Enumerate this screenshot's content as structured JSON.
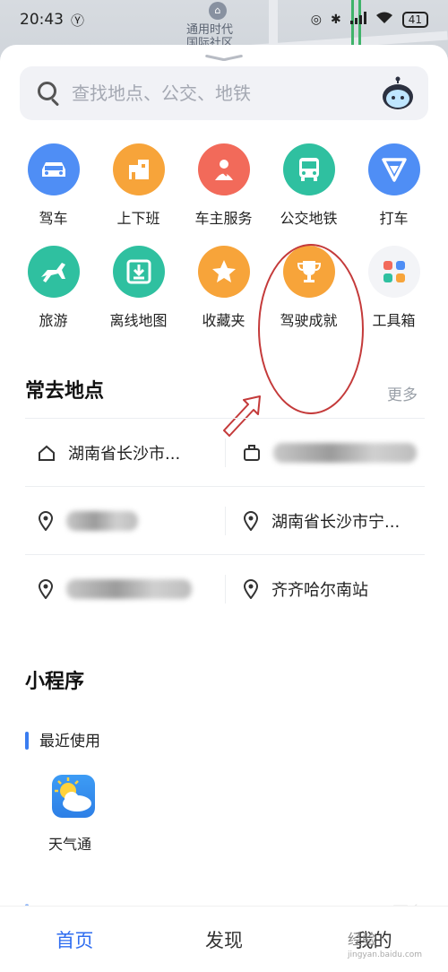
{
  "status": {
    "time": "20:43",
    "battery": "41"
  },
  "map": {
    "poi_line1": "通用时代",
    "poi_line2": "国际社区"
  },
  "search": {
    "placeholder": "查找地点、公交、地铁"
  },
  "grid": {
    "row1": [
      {
        "label": "驾车",
        "color": "#4f8ef5",
        "icon": "car-icon"
      },
      {
        "label": "上下班",
        "color": "#f7a43a",
        "icon": "commute-building-icon"
      },
      {
        "label": "车主服务",
        "color": "#f26a5a",
        "icon": "owner-service-icon"
      },
      {
        "label": "公交地铁",
        "color": "#2fc0a0",
        "icon": "bus-icon"
      },
      {
        "label": "打车",
        "color": "#4f8ef5",
        "icon": "taxi-v-icon"
      }
    ],
    "row2": [
      {
        "label": "旅游",
        "color": "#2fc0a0",
        "icon": "horse-icon"
      },
      {
        "label": "离线地图",
        "color": "#2fc0a0",
        "icon": "download-icon"
      },
      {
        "label": "收藏夹",
        "color": "#f7a43a",
        "icon": "star-icon"
      },
      {
        "label": "驾驶成就",
        "color": "#f7a43a",
        "icon": "trophy-icon"
      },
      {
        "label": "工具箱",
        "color": "#f0f1f4",
        "icon": "toolbox-grid-icon"
      }
    ]
  },
  "frequent": {
    "title": "常去地点",
    "more": "更多",
    "rows": [
      [
        {
          "icon": "home-icon",
          "text": "湖南省长沙市..."
        },
        {
          "icon": "work-icon",
          "text": ""
        }
      ],
      [
        {
          "icon": "location-pin-icon",
          "text": ""
        },
        {
          "icon": "location-pin-icon",
          "text": "湖南省长沙市宁..."
        }
      ],
      [
        {
          "icon": "location-pin-icon",
          "text": ""
        },
        {
          "icon": "location-pin-icon",
          "text": "齐齐哈尔南站"
        }
      ]
    ]
  },
  "mini": {
    "title": "小程序",
    "recent": "最近使用",
    "app_label": "天气通",
    "faded_more": "更多"
  },
  "tabs": [
    "首页",
    "发现",
    "我的"
  ],
  "watermark": {
    "main": "经验",
    "sub": "jingyan.baidu.com"
  }
}
